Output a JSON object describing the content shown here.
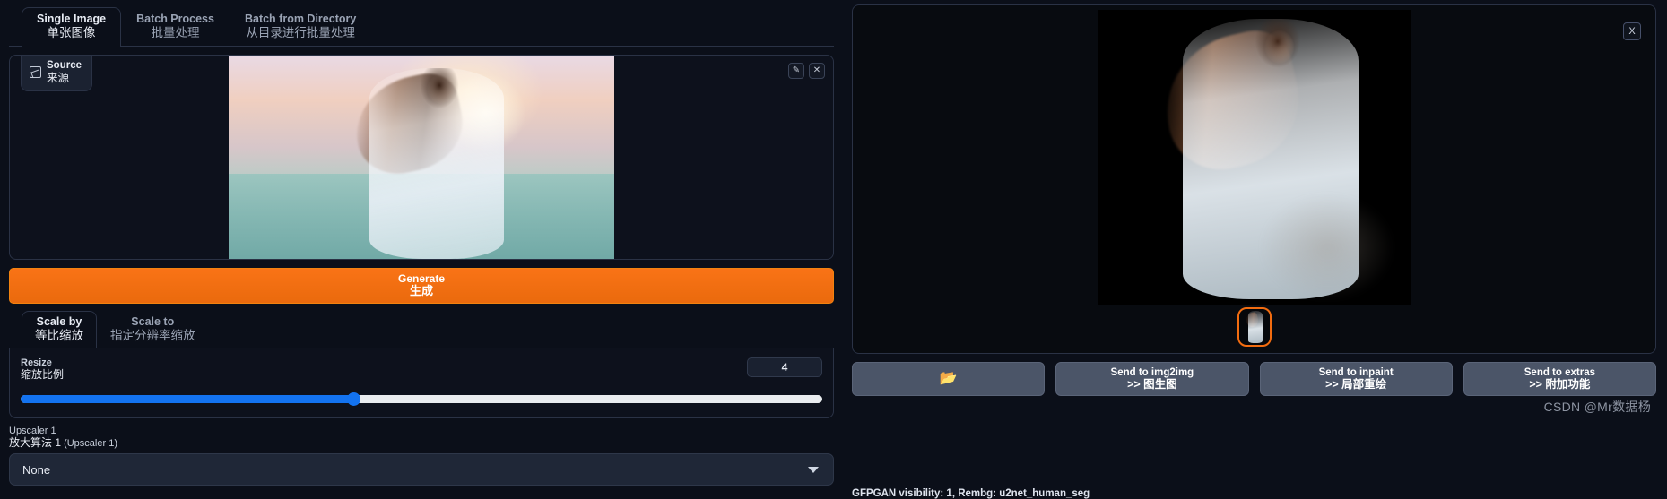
{
  "tabs": [
    {
      "en": "Single Image",
      "cn": "单张图像",
      "active": true
    },
    {
      "en": "Batch Process",
      "cn": "批量处理",
      "active": false
    },
    {
      "en": "Batch from Directory",
      "cn": "从目录进行批量处理",
      "active": false
    }
  ],
  "source": {
    "tag_en": "Source",
    "tag_cn": "来源",
    "edit_icon": "pencil-icon",
    "close_icon": "close-icon",
    "edit_glyph": "✎",
    "close_glyph": "✕"
  },
  "generate": {
    "en": "Generate",
    "cn": "生成"
  },
  "scale_tabs": [
    {
      "en": "Scale by",
      "cn": "等比缩放",
      "active": true
    },
    {
      "en": "Scale to",
      "cn": "指定分辨率缩放",
      "active": false
    }
  ],
  "resize": {
    "label_en": "Resize",
    "label_cn": "缩放比例",
    "value": "4",
    "slider_percent": 41.5
  },
  "upscaler": {
    "label_en": "Upscaler 1",
    "label_cn": "放大算法 1",
    "label_cn_paren": " (Upscaler 1)",
    "selected": "None",
    "chevron_icon": "chevron-down-icon"
  },
  "result": {
    "close_glyph": "X"
  },
  "actions": [
    {
      "icon": "folder-icon",
      "glyph": "📂",
      "en": "",
      "cn": ""
    },
    {
      "icon": "",
      "glyph": "",
      "en": "Send to img2img",
      "cn": ">> 图生图"
    },
    {
      "icon": "",
      "glyph": "",
      "en": "Send to inpaint",
      "cn": ">> 局部重绘"
    },
    {
      "icon": "",
      "glyph": "",
      "en": "Send to extras",
      "cn": ">> 附加功能"
    }
  ],
  "watermark": "CSDN @Mr数据杨",
  "status": "GFPGAN visibility: 1, Rembg: u2net_human_seg",
  "colors": {
    "accent_orange": "#f97316",
    "slider_blue": "#1373f0",
    "panel_bg": "#0b0f19",
    "button_gray": "#4b5568"
  }
}
